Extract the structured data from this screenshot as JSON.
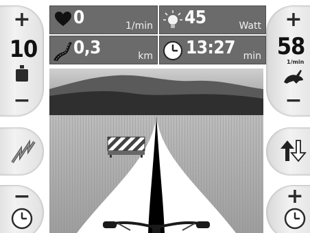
{
  "left": {
    "resistance": {
      "plus": "+",
      "value": "10",
      "minus": "−"
    },
    "mode_button": "bolt-icon",
    "time_minus": {
      "sign": "−",
      "icon": "clock-icon"
    }
  },
  "right": {
    "cadence": {
      "plus": "+",
      "value": "58",
      "unit": "1/min",
      "minus": "−"
    },
    "direction_button": "up-down-arrows-icon",
    "time_plus": {
      "sign": "+",
      "icon": "clock-icon"
    }
  },
  "stats": {
    "heart": {
      "value": "0",
      "unit": "1/min",
      "icon": "heart-icon"
    },
    "power": {
      "value": "45",
      "unit": "Watt",
      "icon": "lightbulb-icon"
    },
    "distance": {
      "value": "0,3",
      "unit": "km",
      "icon": "road-icon"
    },
    "time": {
      "value": "13:27",
      "unit": "min",
      "icon": "clock-icon"
    }
  },
  "scene": {
    "elements": [
      "sky",
      "hills",
      "meadow",
      "road",
      "road-barrier",
      "handlebar"
    ]
  },
  "colors": {
    "panel": "#6b6b6b",
    "pill": "#e6e6e6",
    "sky": "#bdbdbd",
    "hills": "#3a3a3a",
    "road": "#000000"
  }
}
